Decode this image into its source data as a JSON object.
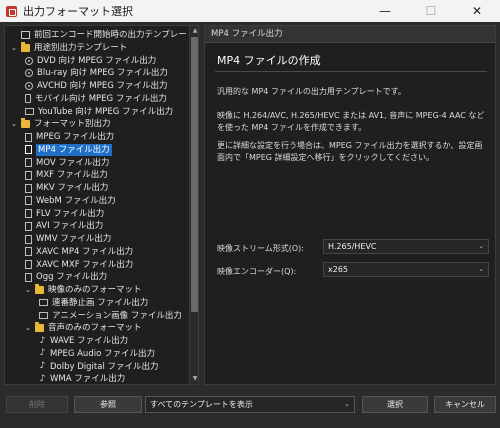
{
  "window": {
    "title": "出力フォーマット選択",
    "min_glyph": "—",
    "max_glyph": "☐",
    "close_glyph": "✕"
  },
  "tree": {
    "items": [
      {
        "label": "前回エンコード開始時の出力テンプレート",
        "icon": "template-icon",
        "level": 0
      },
      {
        "label": "用途別出力テンプレート",
        "icon": "folder-icon",
        "level": 0,
        "expanded": true
      },
      {
        "label": "DVD 向け MPEG ファイル出力",
        "icon": "disc-icon",
        "level": 1
      },
      {
        "label": "Blu-ray 向け MPEG ファイル出力",
        "icon": "disc-icon",
        "level": 1
      },
      {
        "label": "AVCHD 向け MPEG ファイル出力",
        "icon": "disc-icon",
        "level": 1
      },
      {
        "label": "モバイル向け MPEG ファイル出力",
        "icon": "mobile-icon",
        "level": 1
      },
      {
        "label": "YouTube 向け MPEG ファイル出力",
        "icon": "monitor-icon",
        "level": 1
      },
      {
        "label": "フォーマット別出力",
        "icon": "folder-icon",
        "level": 0,
        "expanded": true
      },
      {
        "label": "MPEG ファイル出力",
        "icon": "file-icon",
        "level": 1
      },
      {
        "label": "MP4 ファイル出力",
        "icon": "file-icon",
        "level": 1,
        "selected": true
      },
      {
        "label": "MOV ファイル出力",
        "icon": "file-icon",
        "level": 1
      },
      {
        "label": "MXF ファイル出力",
        "icon": "file-icon",
        "level": 1
      },
      {
        "label": "MKV ファイル出力",
        "icon": "file-icon",
        "level": 1
      },
      {
        "label": "WebM ファイル出力",
        "icon": "file-icon",
        "level": 1
      },
      {
        "label": "FLV ファイル出力",
        "icon": "file-icon",
        "level": 1
      },
      {
        "label": "AVI ファイル出力",
        "icon": "file-icon",
        "level": 1
      },
      {
        "label": "WMV ファイル出力",
        "icon": "file-icon",
        "level": 1
      },
      {
        "label": "XAVC MP4 ファイル出力",
        "icon": "file-icon",
        "level": 1
      },
      {
        "label": "XAVC MXF ファイル出力",
        "icon": "file-icon",
        "level": 1
      },
      {
        "label": "Ogg ファイル出力",
        "icon": "file-icon",
        "level": 1
      },
      {
        "label": "映像のみのフォーマット",
        "icon": "folder-icon",
        "level": 1,
        "expanded": true
      },
      {
        "label": "連番静止画 ファイル出力",
        "icon": "film-icon",
        "level": 2
      },
      {
        "label": "アニメーション画像 ファイル出力",
        "icon": "film-icon",
        "level": 2
      },
      {
        "label": "音声のみのフォーマット",
        "icon": "folder-icon",
        "level": 1,
        "expanded": true
      },
      {
        "label": "WAVE ファイル出力",
        "icon": "note-icon",
        "level": 2
      },
      {
        "label": "MPEG Audio ファイル出力",
        "icon": "note-icon",
        "level": 2
      },
      {
        "label": "Dolby Digital ファイル出力",
        "icon": "note-icon",
        "level": 2
      },
      {
        "label": "WMA ファイル出力",
        "icon": "note-icon",
        "level": 2
      }
    ]
  },
  "detail": {
    "header": "MP4 ファイル出力",
    "title": "MP4 ファイルの作成",
    "para1": "汎用的な MP4 ファイルの出力用テンプレートです。",
    "para2": "映像に H.264/AVC, H.265/HEVC または AV1, 音声に MPEG-4 AAC などを使った MP4 ファイルを作成できます。",
    "para3": "更に詳細な設定を行う場合は、MPEG ファイル出力を選択するか、設定画面内で「MPEG 詳細設定へ移行」をクリックしてください。",
    "stream_label": "映像ストリーム形式(O):",
    "stream_value": "H.265/HEVC",
    "encoder_label": "映像エンコーダー(Q):",
    "encoder_value": "x265"
  },
  "footer": {
    "delete_label": "削除",
    "browse_label": "参照",
    "filter_value": "すべてのテンプレートを表示",
    "select_label": "選択",
    "cancel_label": "キャンセル"
  }
}
